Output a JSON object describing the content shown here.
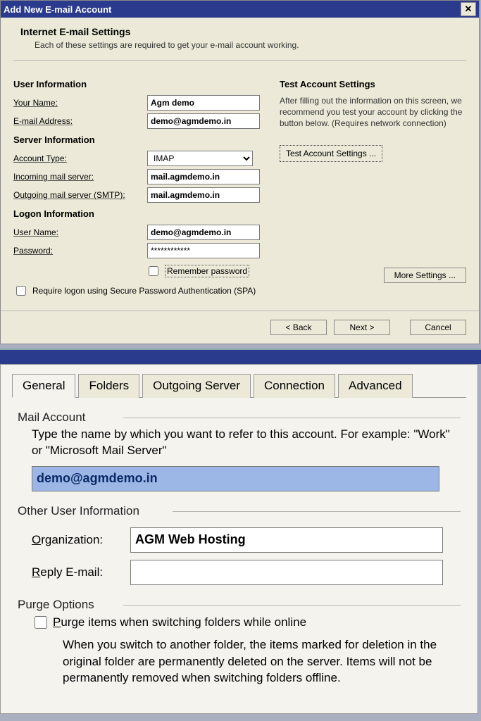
{
  "titlebar": {
    "title": "Add New E-mail Account"
  },
  "dialog": {
    "heading": "Internet E-mail Settings",
    "subheading": "Each of these settings are required to get your e-mail account working."
  },
  "userinfo": {
    "section": "User Information",
    "yourname_lbl": "Your Name:",
    "yourname_val": "Agm demo",
    "email_lbl": "E-mail Address:",
    "email_val": "demo@agmdemo.in"
  },
  "serverinfo": {
    "section": "Server Information",
    "accounttype_lbl": "Account Type:",
    "accounttype_val": "IMAP",
    "incoming_lbl": "Incoming mail server:",
    "incoming_val": "mail.agmdemo.in",
    "outgoing_lbl": "Outgoing mail server (SMTP):",
    "outgoing_val": "mail.agmdemo.in"
  },
  "logon": {
    "section": "Logon Information",
    "user_lbl": "User Name:",
    "user_val": "demo@agmdemo.in",
    "pass_lbl": "Password:",
    "pass_val": "************",
    "remember_lbl": "Remember password",
    "spa_lbl": "Require logon using Secure Password Authentication (SPA)"
  },
  "testarea": {
    "heading": "Test Account Settings",
    "desc": "After filling out the information on this screen, we recommend you test your account by clicking the button below. (Requires network connection)",
    "btn": "Test Account Settings ..."
  },
  "more_btn": "More Settings ...",
  "nav": {
    "back": "< Back",
    "next": "Next >",
    "cancel": "Cancel"
  },
  "settings": {
    "tabs": [
      "General",
      "Folders",
      "Outgoing Server",
      "Connection",
      "Advanced"
    ],
    "mailaccount": {
      "title": "Mail Account",
      "desc": "Type the name by which you want to refer to this account. For example: \"Work\" or \"Microsoft Mail Server\"",
      "value": "demo@agmdemo.in"
    },
    "otheruser": {
      "title": "Other User Information",
      "org_lbl": "Organization:",
      "org_val": "AGM Web Hosting",
      "reply_lbl": "Reply E-mail:",
      "reply_val": ""
    },
    "purge": {
      "title": "Purge Options",
      "cb_lbl": "Purge items when switching folders while online",
      "desc": "When you switch to another folder, the items marked for deletion in the original folder are permanently deleted on the server. Items will not be permanently removed when switching folders offline."
    }
  }
}
